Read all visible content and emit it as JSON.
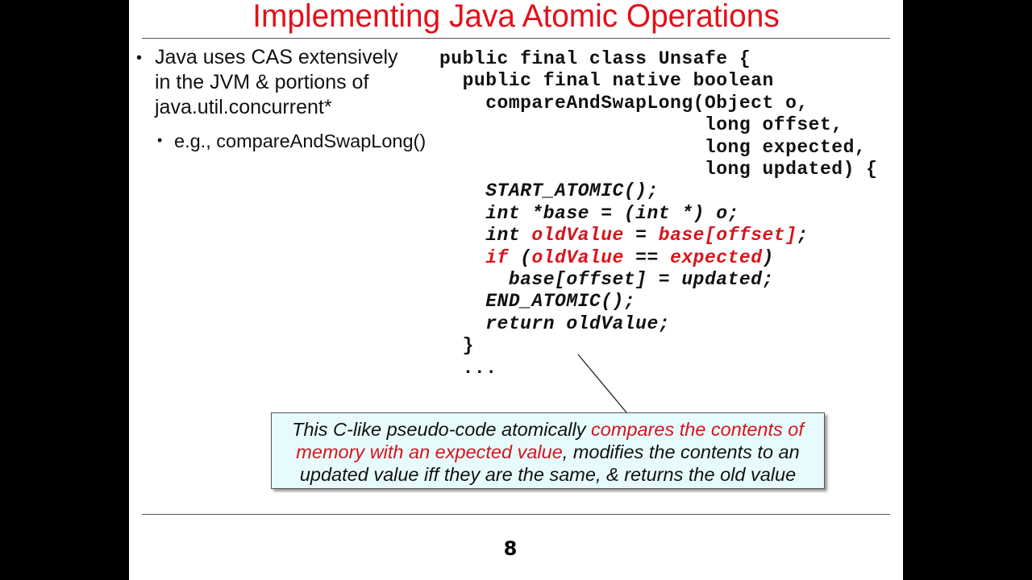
{
  "slide": {
    "title": "Implementing Java Atomic Operations",
    "bullets": [
      {
        "lines": [
          "Java uses CAS extensively",
          "in the JVM & portions of",
          "java.util.concurrent*"
        ]
      },
      {
        "sub": "e.g., compareAndSwapLong()"
      }
    ],
    "code": [
      [
        {
          "t": "public final class Unsafe {"
        }
      ],
      [
        {
          "t": "  public final native boolean"
        }
      ],
      [
        {
          "t": "    compareAndSwapLong(Object o,"
        }
      ],
      [
        {
          "t": "                       long offset,"
        }
      ],
      [
        {
          "t": "                       long expected,"
        }
      ],
      [
        {
          "t": "                       long updated) {"
        }
      ],
      [
        {
          "t": "    START_ATOMIC();",
          "i": true
        }
      ],
      [
        {
          "t": "    int *base = (int *) o;",
          "i": true
        }
      ],
      [
        {
          "t": "    int ",
          "i": true
        },
        {
          "t": "oldValue",
          "i": true,
          "r": true
        },
        {
          "t": " = ",
          "i": true
        },
        {
          "t": "base[offset]",
          "i": true,
          "r": true
        },
        {
          "t": ";",
          "i": true
        }
      ],
      [
        {
          "t": "    ",
          "i": true
        },
        {
          "t": "if",
          "i": true,
          "r": true
        },
        {
          "t": " (",
          "i": true
        },
        {
          "t": "oldValue",
          "i": true,
          "r": true
        },
        {
          "t": " == ",
          "i": true
        },
        {
          "t": "expected",
          "i": true,
          "r": true
        },
        {
          "t": ")",
          "i": true
        }
      ],
      [
        {
          "t": "      base[offset] = updated;",
          "i": true
        }
      ],
      [
        {
          "t": "    END_ATOMIC();",
          "i": true
        }
      ],
      [
        {
          "t": "    return oldValue;",
          "i": true
        }
      ],
      [
        {
          "t": "  }"
        }
      ],
      [
        {
          "t": "  ..."
        }
      ]
    ],
    "callout": {
      "before": "This C-like pseudo-code atomically ",
      "highlight": "compares the contents of memory with an expected value",
      "after": ", modifies the contents to an updated value iff they are the same, & returns the old value"
    },
    "page_number": "8",
    "colors": {
      "accent": "#e3101a",
      "callout_bg": "#e8fbfc"
    }
  }
}
